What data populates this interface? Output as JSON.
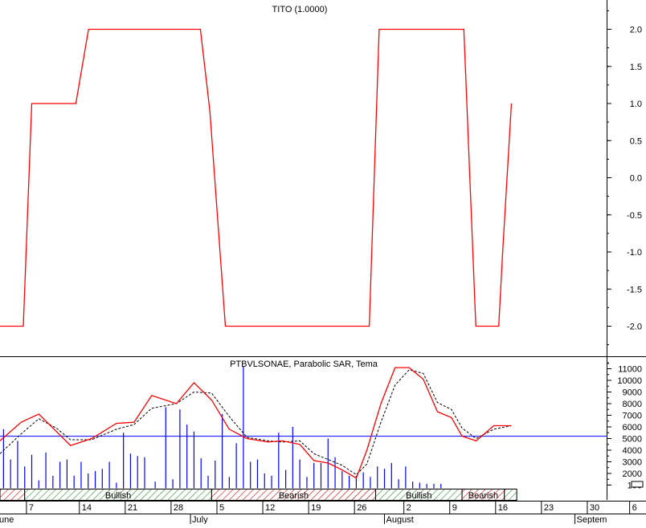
{
  "colors": {
    "indicator_line": "#ff0000",
    "ema_line": "#000000",
    "volume_bar": "#0000ff",
    "reference_line": "#0000ff",
    "bullish_hatch": "#2e8b2e",
    "bearish_hatch": "#e00000",
    "axis": "#000000",
    "background": "#ffffff"
  },
  "zoom_box_label": "",
  "chart_data": [
    {
      "type": "line",
      "title": "TITO (1.0000)",
      "ylim": [
        -2.5,
        2.5
      ],
      "y_ticks": [
        "2.0",
        "1.5",
        "1.0",
        "0.5",
        "0.0",
        "-0.5",
        "-1.0",
        "-1.5",
        "-2.0"
      ],
      "y_tick_values": [
        2.0,
        1.5,
        1.0,
        0.5,
        0.0,
        -0.5,
        -1.0,
        -1.5,
        -2.0
      ],
      "grid": false,
      "series": [
        {
          "color": "#ff0000",
          "x": [
            0,
            6.6,
            9.0,
            21.5,
            25.1,
            56.8,
            59.5,
            63.9,
            104.7,
            107.5,
            131.5,
            134.9,
            141.4,
            142.5,
            145.0
          ],
          "y": [
            -2.0,
            -2.0,
            1.0,
            1.0,
            2.0,
            2.0,
            0.9,
            -2.0,
            -2.0,
            2.0,
            2.0,
            -2.0,
            -2.0,
            -1.0,
            1.0
          ]
        }
      ]
    },
    {
      "type": "bar",
      "title": "PTBVLSONAE, Parabolic SAR, Tema",
      "ylim": [
        0,
        12000
      ],
      "y_ticks": [
        "11000",
        "10000",
        "9000",
        "8000",
        "7000",
        "6000",
        "5000",
        "4000",
        "3000",
        "2000",
        "100"
      ],
      "y_tick_values": [
        11000,
        10000,
        9000,
        8000,
        7000,
        6000,
        5000,
        4000,
        3000,
        2000,
        1000
      ],
      "reference_value": 5200,
      "volume": {
        "x": [
          1,
          3,
          5,
          7,
          9,
          11,
          13,
          15,
          17,
          19,
          21,
          23,
          25,
          27,
          29,
          31,
          33,
          35,
          37,
          39,
          41,
          44,
          47,
          49,
          51,
          53,
          55,
          57,
          59,
          61,
          63,
          65,
          67,
          69,
          71,
          73,
          75,
          77,
          79,
          81,
          83,
          85,
          87,
          89,
          91,
          93,
          95,
          97,
          99,
          101,
          103,
          105,
          107,
          109,
          111,
          113,
          115,
          117,
          119,
          121,
          123,
          125,
          127,
          129,
          131,
          133,
          135,
          137,
          139,
          141,
          143,
          145
        ],
        "values": [
          5800,
          3200,
          4800,
          2600,
          3600,
          1400,
          3800,
          1800,
          3000,
          3200,
          1800,
          3000,
          2000,
          2200,
          2400,
          3000,
          1200,
          5500,
          3700,
          3500,
          3400,
          1300,
          7700,
          1500,
          7500,
          6200,
          5600,
          3300,
          1800,
          3100,
          7100,
          1700,
          4600,
          11200,
          3000,
          3200,
          2000,
          1800,
          5500,
          2300,
          6000,
          3200,
          1700,
          2900,
          2900,
          5000,
          3400,
          2200,
          1800,
          1800,
          2100,
          1700,
          2600,
          2400,
          2900,
          1500,
          2600,
          1300,
          1200,
          1100,
          1100,
          1100,
          1000,
          1000,
          1000,
          1000,
          1000,
          1000,
          1000,
          1000,
          1000,
          1000
        ]
      },
      "close": {
        "x": [
          0,
          6,
          11,
          16,
          20,
          26,
          33,
          38,
          43,
          50,
          55,
          60,
          65,
          70,
          76,
          80,
          85,
          89,
          93,
          97,
          101,
          104,
          108,
          112,
          116,
          120,
          124,
          128,
          131,
          135,
          140,
          145
        ],
        "values": [
          4800,
          6400,
          7100,
          5600,
          4400,
          5000,
          6300,
          6400,
          8700,
          8000,
          9800,
          8300,
          5800,
          5000,
          4700,
          4800,
          4500,
          3100,
          2900,
          2300,
          1600,
          4000,
          8000,
          11100,
          11100,
          10100,
          7300,
          6800,
          5200,
          4800,
          6100,
          6100
        ]
      },
      "ema": {
        "x": [
          0,
          6,
          11,
          16,
          20,
          26,
          33,
          38,
          43,
          50,
          55,
          60,
          65,
          70,
          76,
          80,
          85,
          89,
          93,
          97,
          101,
          104,
          108,
          112,
          116,
          120,
          124,
          128,
          131,
          135,
          140,
          145
        ],
        "values": [
          3700,
          5400,
          6700,
          5900,
          4900,
          4900,
          5800,
          6200,
          7600,
          8000,
          9000,
          8900,
          6900,
          5100,
          4800,
          4700,
          4800,
          3700,
          3200,
          2700,
          1900,
          2800,
          6400,
          9600,
          10900,
          10600,
          8100,
          7500,
          5900,
          5000,
          5800,
          6100
        ]
      },
      "signal_bands": [
        {
          "x0": 0,
          "x1": 7,
          "state": "bearish",
          "label": ""
        },
        {
          "x0": 7,
          "x1": 60,
          "state": "bullish",
          "label": "Bullish"
        },
        {
          "x0": 60,
          "x1": 106.5,
          "state": "bearish",
          "label": "Bearish"
        },
        {
          "x0": 106.5,
          "x1": 131,
          "state": "bullish",
          "label": "Bullish"
        },
        {
          "x0": 131,
          "x1": 143,
          "state": "bearish",
          "label": "Bearish"
        },
        {
          "x0": 143,
          "x1": 146.5,
          "state": "bullish",
          "label": ""
        }
      ]
    }
  ],
  "x_axis": {
    "day_ticks": [
      {
        "x": 7.5,
        "label": "7"
      },
      {
        "x": 22.5,
        "label": "14"
      },
      {
        "x": 35.5,
        "label": "21"
      },
      {
        "x": 48.5,
        "label": "28"
      },
      {
        "x": 61.5,
        "label": "5"
      },
      {
        "x": 74.5,
        "label": "12"
      },
      {
        "x": 87.5,
        "label": "19"
      },
      {
        "x": 100.5,
        "label": "26"
      },
      {
        "x": 114.5,
        "label": "2"
      },
      {
        "x": 127.5,
        "label": "9"
      },
      {
        "x": 140.5,
        "label": "16"
      },
      {
        "x": 153.5,
        "label": "23"
      },
      {
        "x": 166.5,
        "label": "30"
      },
      {
        "x": 178.5,
        "label": "6"
      }
    ],
    "month_labels": [
      {
        "x": 0,
        "label": "une"
      },
      {
        "x": 54,
        "label": "July"
      },
      {
        "x": 109,
        "label": "August"
      },
      {
        "x": 163,
        "label": "Septem"
      }
    ],
    "tick_x": [
      7.5,
      22.5,
      35.5,
      48.5,
      61.5,
      74.5,
      87.5,
      100.5,
      114.5,
      127.5,
      140.5,
      153.5,
      166.5,
      178.5
    ],
    "month_x": [
      0,
      54,
      109,
      163
    ],
    "xlim": [
      0,
      183
    ]
  }
}
